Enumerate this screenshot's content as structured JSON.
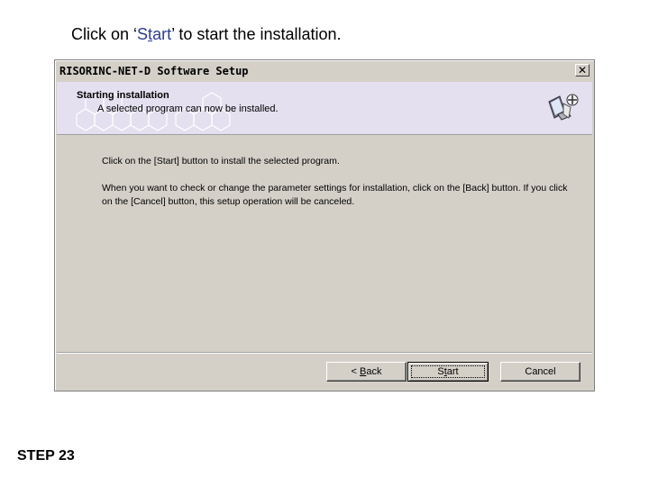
{
  "instruction": {
    "before": "Click on ‘",
    "highlight_first": "S",
    "highlight_underlined": "t",
    "highlight_rest": "art",
    "after": "’ to start the installation."
  },
  "window": {
    "title": "RISORINC-NET-D Software Setup",
    "close_glyph": "✕"
  },
  "header": {
    "title": "Starting installation",
    "subtitle": "A selected program can now be installed."
  },
  "body": {
    "line1": "Click on the [Start] button to install the selected program.",
    "line2": "When you want to check or change the parameter settings for installation, click on the [Back] button. If you click on the [Cancel] button, this setup operation will be canceled."
  },
  "buttons": {
    "back": {
      "prefix": "< ",
      "mnemonic": "B",
      "rest": "ack"
    },
    "start": {
      "first": "S",
      "mnemonic": "t",
      "rest": "art"
    },
    "cancel": {
      "label": "Cancel"
    }
  },
  "step_label": "STEP 23",
  "icons": {
    "header_graphic": "computer-setup-icon",
    "decoration": "hexagon-pattern"
  },
  "colors": {
    "instruction_highlight": "#2c3c93",
    "header_bg": "#e4e0f0",
    "dialog_bg": "#d4d0c8"
  }
}
